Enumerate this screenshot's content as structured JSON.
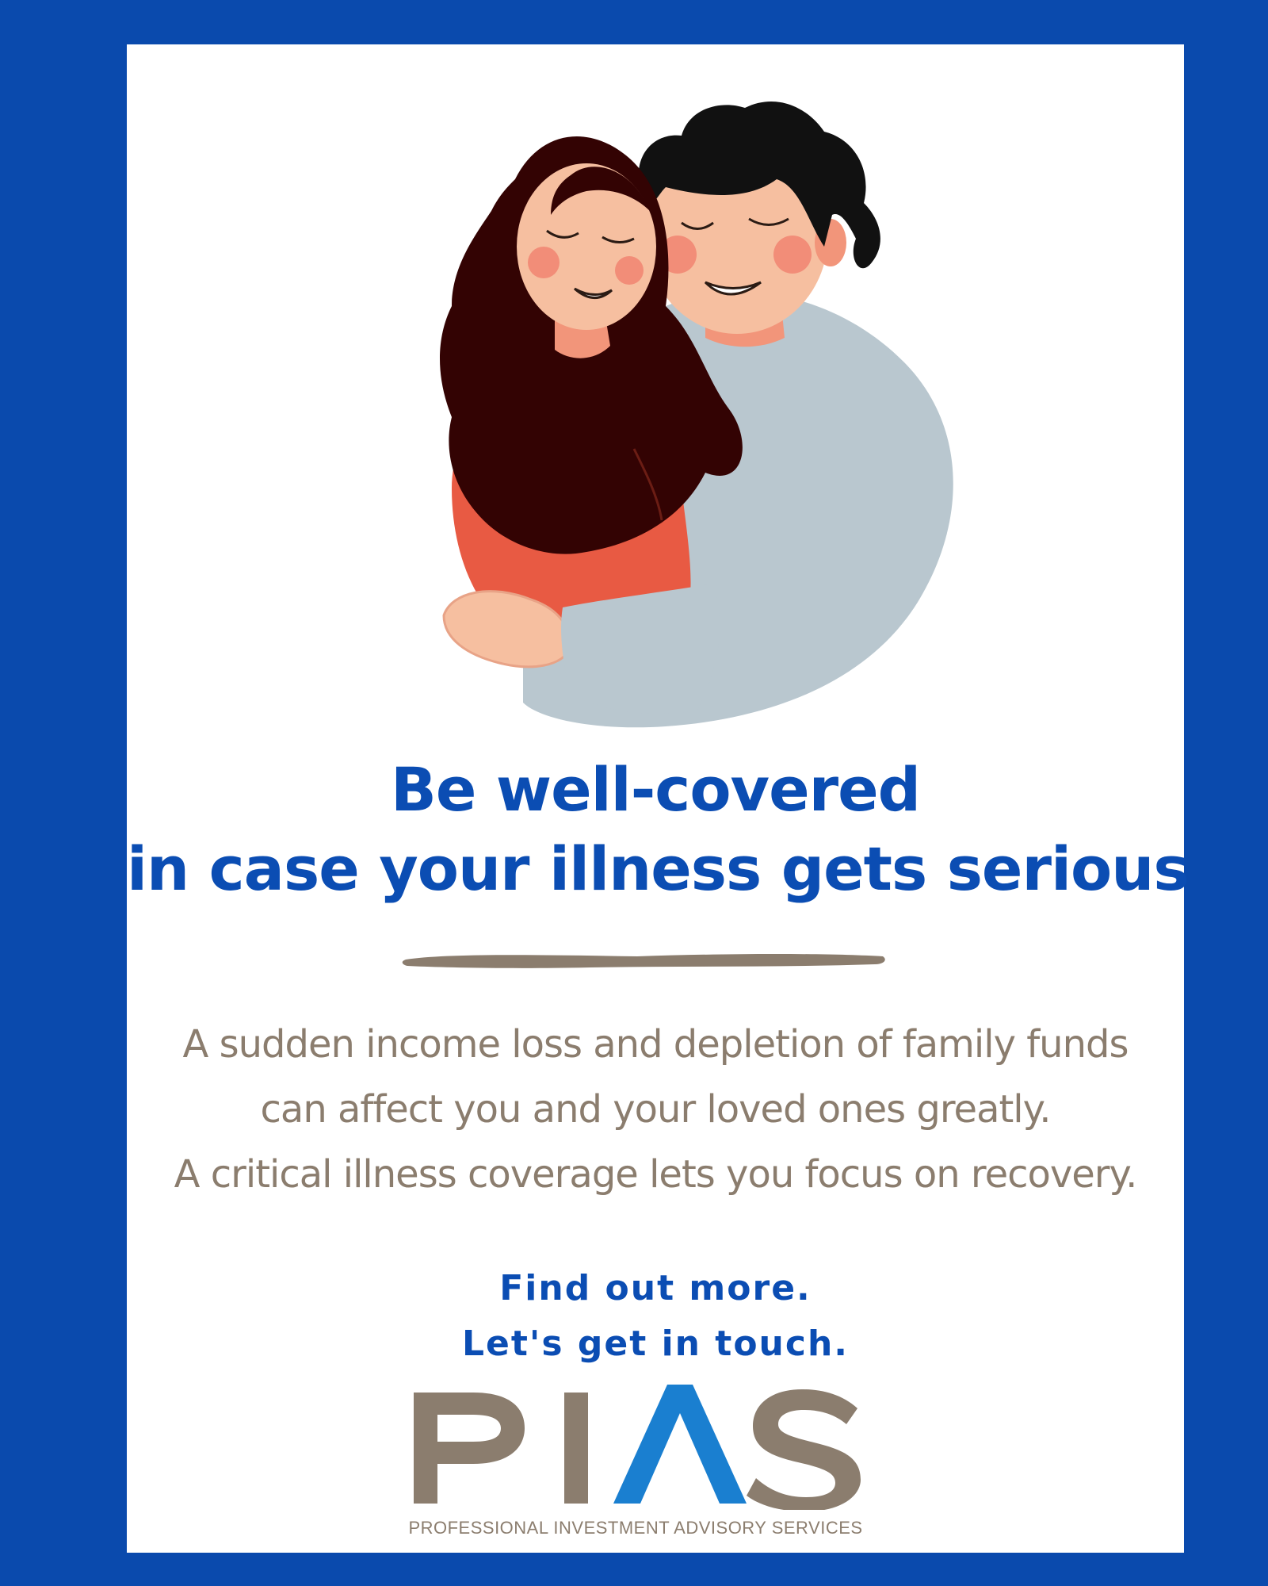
{
  "headline": {
    "line1": "Be well-covered",
    "line2": "in case your illness gets serious"
  },
  "body": {
    "line1": "A sudden income loss and depletion of family funds",
    "line2": "can affect you and your loved ones greatly.",
    "line3": "A critical illness coverage lets you focus on recovery."
  },
  "cta": {
    "line1": "Find out more.",
    "line2": "Let's get in touch."
  },
  "logo": {
    "wordmark": "PIAS",
    "tagline": "PROFESSIONAL INVESTMENT ADVISORY SERVICES"
  },
  "colors": {
    "frame": "#0a4aad",
    "headline": "#0b4db3",
    "body_text": "#8b7d6e",
    "logo_accent": "#1a7fd0"
  }
}
